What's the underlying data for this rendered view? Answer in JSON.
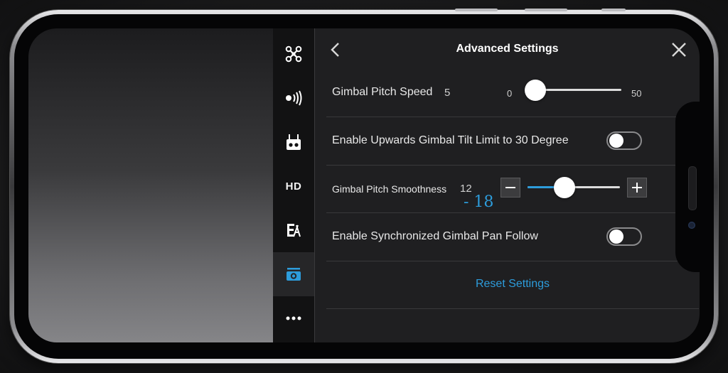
{
  "panel": {
    "title": "Advanced Settings"
  },
  "nav": {
    "items": [
      {
        "icon": "drone-icon"
      },
      {
        "icon": "signal-icon"
      },
      {
        "icon": "remote-controller-icon"
      },
      {
        "icon": "hd-icon",
        "label": "HD"
      },
      {
        "icon": "battery-flash-icon"
      },
      {
        "icon": "gimbal-camera-icon",
        "active": true
      },
      {
        "icon": "more-icon"
      }
    ]
  },
  "settings": {
    "pitch_speed": {
      "label": "Gimbal Pitch Speed",
      "value": "5",
      "min": "0",
      "max": "50",
      "level": 0.1
    },
    "tilt_limit": {
      "label": "Enable Upwards Gimbal Tilt Limit to 30 Degree",
      "enabled": false
    },
    "pitch_smoothness": {
      "label": "Gimbal Pitch Smoothness",
      "value": "12",
      "level": 0.4,
      "annotation": "- 18"
    },
    "pan_follow": {
      "label": "Enable Synchronized Gimbal Pan Follow",
      "enabled": false
    },
    "reset": {
      "label": "Reset Settings"
    }
  },
  "colors": {
    "accent": "#2d9cdb",
    "panel_bg": "#1f1f21",
    "nav_bg": "#121213"
  }
}
